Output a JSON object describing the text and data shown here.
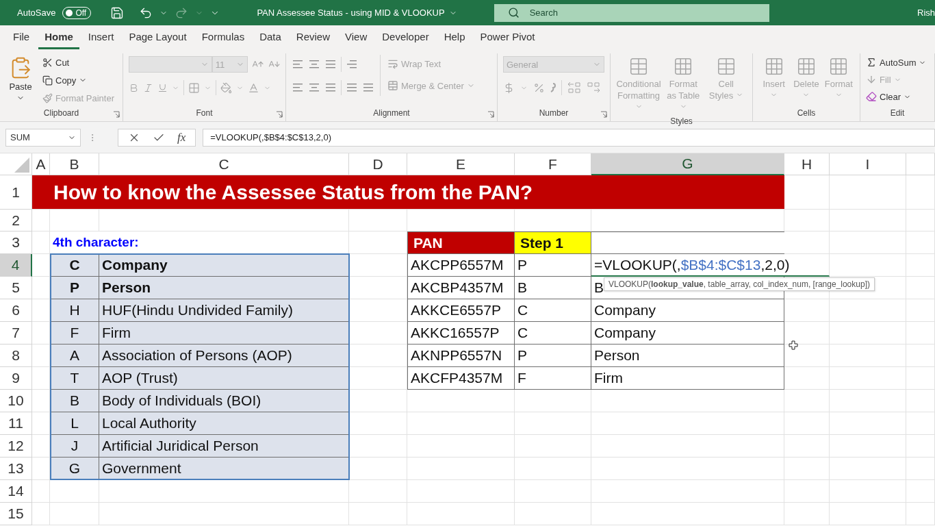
{
  "title_bar": {
    "autosave_label": "AutoSave",
    "autosave": {
      "on": false,
      "label": "Off"
    },
    "document_title": "PAN Assessee Status - using MID & VLOOKUP",
    "search_placeholder": "Search",
    "user": "Rish"
  },
  "ribbon_tabs": [
    {
      "label": "File",
      "selected": false
    },
    {
      "label": "Home",
      "selected": true
    },
    {
      "label": "Insert",
      "selected": false
    },
    {
      "label": "Page Layout",
      "selected": false
    },
    {
      "label": "Formulas",
      "selected": false
    },
    {
      "label": "Data",
      "selected": false
    },
    {
      "label": "Review",
      "selected": false
    },
    {
      "label": "View",
      "selected": false
    },
    {
      "label": "Developer",
      "selected": false
    },
    {
      "label": "Help",
      "selected": false
    },
    {
      "label": "Power Pivot",
      "selected": false
    }
  ],
  "ribbon_groups": [
    {
      "label": "Clipboard",
      "items": [
        {
          "label": "Paste",
          "disabled": false
        },
        {
          "label": "Cut",
          "disabled": false
        },
        {
          "label": "Copy",
          "disabled": false
        },
        {
          "label": "Format Painter",
          "disabled": true
        }
      ]
    },
    {
      "label": "Font",
      "font_size": "11",
      "disabled": true
    },
    {
      "label": "Alignment",
      "items": [
        {
          "label": "Wrap Text",
          "disabled": true
        },
        {
          "label": "Merge & Center",
          "disabled": true
        }
      ]
    },
    {
      "label": "Number",
      "format": "General",
      "disabled": true
    },
    {
      "label": "Styles",
      "items": [
        {
          "label": "Conditional Formatting",
          "disabled": true
        },
        {
          "label": "Format as Table",
          "disabled": true
        },
        {
          "label": "Cell Styles",
          "disabled": true
        }
      ]
    },
    {
      "label": "Cells",
      "items": [
        {
          "label": "Insert",
          "disabled": true
        },
        {
          "label": "Delete",
          "disabled": true
        },
        {
          "label": "Format",
          "disabled": true
        }
      ]
    },
    {
      "label": "Edit",
      "items": [
        {
          "label": "AutoSum",
          "disabled": false
        },
        {
          "label": "Fill",
          "disabled": true
        },
        {
          "label": "Clear",
          "disabled": false
        }
      ]
    }
  ],
  "formula_bar": {
    "name_box": "SUM",
    "function_label": "fx",
    "formula": "=VLOOKUP(,$B$4:$C$13,2,0)"
  },
  "columns": [
    {
      "label": "A",
      "selected": false
    },
    {
      "label": "B",
      "selected": false
    },
    {
      "label": "C",
      "selected": false
    },
    {
      "label": "D",
      "selected": false
    },
    {
      "label": "E",
      "selected": false
    },
    {
      "label": "F",
      "selected": false
    },
    {
      "label": "G",
      "selected": true
    },
    {
      "label": "H",
      "selected": false
    },
    {
      "label": "I",
      "selected": false
    }
  ],
  "rows": [
    {
      "label": "1",
      "selected": false
    },
    {
      "label": "2",
      "selected": false
    },
    {
      "label": "3",
      "selected": false
    },
    {
      "label": "4",
      "selected": true
    },
    {
      "label": "5",
      "selected": false
    },
    {
      "label": "6",
      "selected": false
    },
    {
      "label": "7",
      "selected": false
    },
    {
      "label": "8",
      "selected": false
    },
    {
      "label": "9",
      "selected": false
    },
    {
      "label": "10",
      "selected": false
    },
    {
      "label": "11",
      "selected": false
    },
    {
      "label": "12",
      "selected": false
    },
    {
      "label": "13",
      "selected": false
    },
    {
      "label": "14",
      "selected": false
    },
    {
      "label": "15",
      "selected": false
    }
  ],
  "sheet": {
    "title": "How to know the Assessee Status from the PAN?",
    "code_heading": "4th character:",
    "code_table": {
      "selected": true,
      "rows": [
        {
          "code": "C",
          "status": "Company",
          "bold": true
        },
        {
          "code": "P",
          "status": "Person",
          "bold": true
        },
        {
          "code": "H",
          "status": "HUF(Hindu Undivided Family)",
          "bold": false
        },
        {
          "code": "F",
          "status": "Firm",
          "bold": false
        },
        {
          "code": "A",
          "status": "Association of Persons (AOP)",
          "bold": false
        },
        {
          "code": "T",
          "status": "AOP (Trust)",
          "bold": false
        },
        {
          "code": "B",
          "status": "Body of Individuals (BOI)",
          "bold": false
        },
        {
          "code": "L",
          "status": "Local Authority",
          "bold": false
        },
        {
          "code": "J",
          "status": "Artificial Juridical Person",
          "bold": false
        },
        {
          "code": "G",
          "status": "Government",
          "bold": false
        }
      ]
    },
    "pan_table": {
      "headers": [
        "PAN",
        "Step 1"
      ],
      "rows": [
        {
          "pan": "AKCPP6557M",
          "step1": "P",
          "kind": "editing",
          "formula_parts": [
            {
              "text": "=VLOOKUP(,",
              "kind": "plain"
            },
            {
              "text": "$B$4:$C$13",
              "kind": "reference"
            },
            {
              "text": ",2,0)",
              "kind": "plain"
            }
          ]
        },
        {
          "pan": "AKCBP4357M",
          "step1": "B",
          "kind": "value",
          "result": "B"
        },
        {
          "pan": "AKKCE6557P",
          "step1": "C",
          "kind": "value",
          "result": "Company"
        },
        {
          "pan": "AKKC16557P",
          "step1": "C",
          "kind": "value",
          "result": "Company"
        },
        {
          "pan": "AKNPP6557N",
          "step1": "P",
          "kind": "value",
          "result": "Person"
        },
        {
          "pan": "AKCFP4357M",
          "step1": "F",
          "kind": "value",
          "result": "Firm"
        }
      ]
    },
    "tooltip": "VLOOKUP(**lookup_value**, table_array, col_index_num, [range_lookup])"
  }
}
